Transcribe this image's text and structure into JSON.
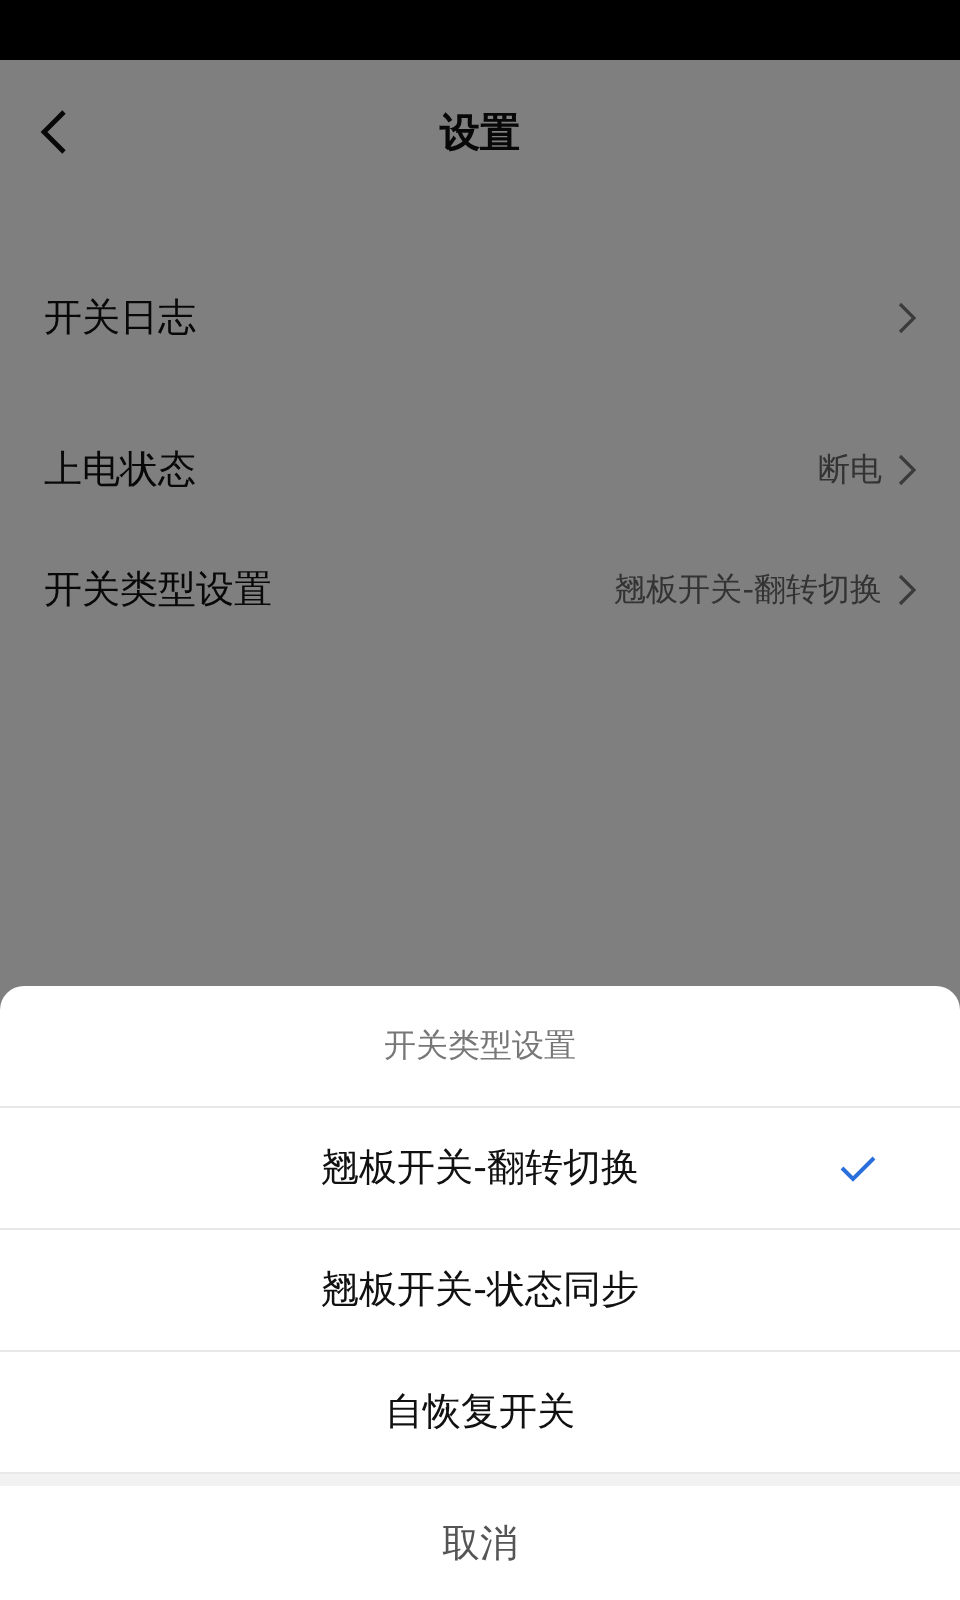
{
  "header": {
    "title": "设置"
  },
  "setting_groups": [
    {
      "items": [
        {
          "label": "开关日志"
        }
      ]
    },
    {
      "items": [
        {
          "label": "上电状态",
          "value": "断电"
        },
        {
          "label": "开关类型设置",
          "value": "翘板开关-翻转切换"
        }
      ]
    }
  ],
  "sheet": {
    "title": "开关类型设置",
    "options": [
      {
        "label": "翘板开关-翻转切换",
        "selected": true
      },
      {
        "label": "翘板开关-状态同步",
        "selected": false
      },
      {
        "label": "自恢复开关",
        "selected": false
      }
    ],
    "cancel": "取消"
  }
}
